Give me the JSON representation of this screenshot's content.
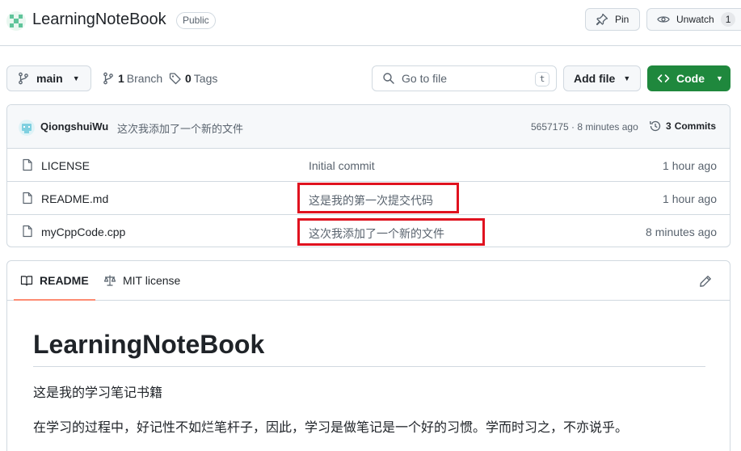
{
  "repo": {
    "name": "LearningNoteBook",
    "visibility": "Public",
    "pin_label": "Pin",
    "watch_label": "Unwatch",
    "watch_count": "1"
  },
  "toolbar": {
    "branch": "main",
    "branch_count": "1",
    "branch_label": "Branch",
    "tag_count": "0",
    "tag_label": "Tags",
    "goto_placeholder": "Go to file",
    "goto_shortcut": "t",
    "add_file_label": "Add file",
    "code_label": "Code"
  },
  "latest_commit": {
    "author": "QiongshuiWu",
    "message": "这次我添加了一个新的文件",
    "meta": "5657175 · 8 minutes ago",
    "commits_count": "3",
    "commits_label": "Commits"
  },
  "files": [
    {
      "name": "LICENSE",
      "message": "Initial commit",
      "time": "1 hour ago",
      "highlighted": false
    },
    {
      "name": "README.md",
      "message": "这是我的第一次提交代码",
      "time": "1 hour ago",
      "highlighted": true
    },
    {
      "name": "myCppCode.cpp",
      "message": "这次我添加了一个新的文件",
      "time": "8 minutes ago",
      "highlighted": true
    }
  ],
  "readme": {
    "tab_readme": "README",
    "tab_license": "MIT license",
    "heading": "LearningNoteBook",
    "paragraph1": "这是我的学习笔记书籍",
    "paragraph2": "在学习的过程中，好记性不如烂笔杆子，因此，学习是做笔记是一个好的习惯。学而时习之，不亦说乎。"
  },
  "colors": {
    "accent_green": "#1f883d",
    "highlight_red": "#e0121f",
    "tab_underline": "#fd8c73"
  }
}
